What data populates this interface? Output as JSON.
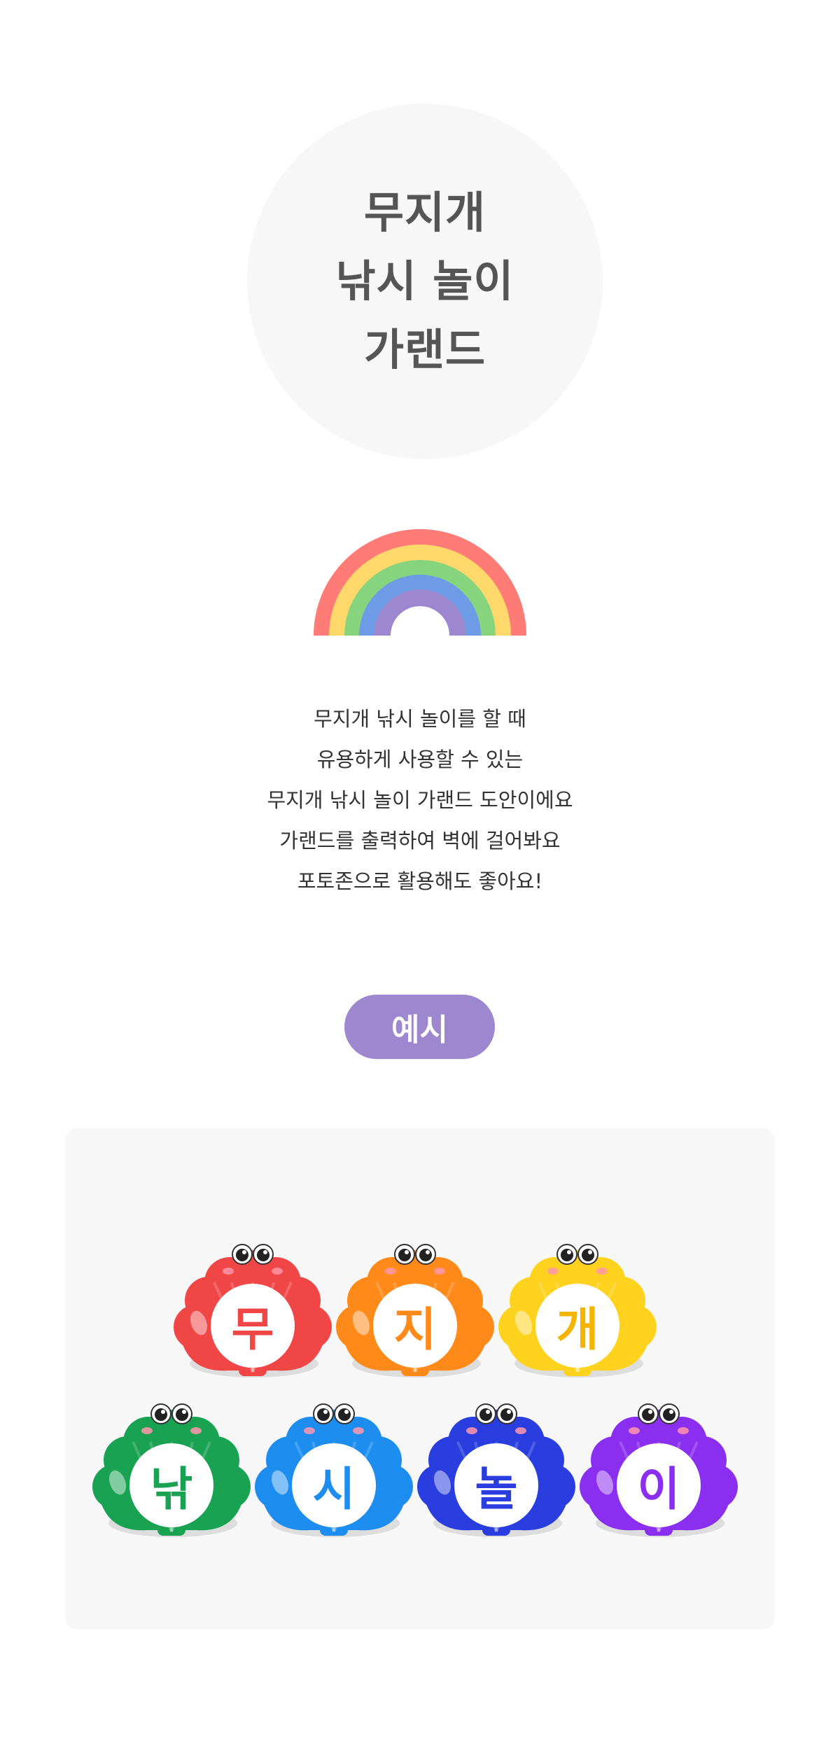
{
  "hero": {
    "title_lines": [
      "무지개",
      "낚시 놀이",
      "가랜드"
    ]
  },
  "rainbow": {
    "colors": [
      "#ff7b76",
      "#ffd86b",
      "#86d47e",
      "#6e9be6",
      "#9d88d0"
    ]
  },
  "description": {
    "lines": [
      "무지개 낚시 놀이를 할 때",
      "유용하게 사용할 수 있는",
      "무지개 낚시 놀이 가랜드 도안이에요",
      "가랜드를 출력하여 벽에 걸어봐요",
      "포토존으로 활용해도 좋아요!"
    ]
  },
  "example": {
    "badge_label": "예시",
    "badge_color": "#9d88d0"
  },
  "garland": {
    "shells": [
      {
        "letter": "무",
        "color": "#f04646",
        "text_color": "#f04646"
      },
      {
        "letter": "지",
        "color": "#ff8a1a",
        "text_color": "#ff8a1a"
      },
      {
        "letter": "개",
        "color": "#ffd21e",
        "text_color": "#f5b400"
      },
      {
        "letter": "낚",
        "color": "#1aa253",
        "text_color": "#1aa253"
      },
      {
        "letter": "시",
        "color": "#1d8ef0",
        "text_color": "#1d8ef0"
      },
      {
        "letter": "놀",
        "color": "#2a3ee0",
        "text_color": "#2a3ee0"
      },
      {
        "letter": "이",
        "color": "#8a2ff0",
        "text_color": "#8a2ff0"
      }
    ]
  }
}
